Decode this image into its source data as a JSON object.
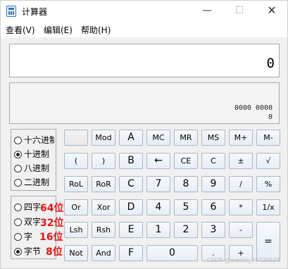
{
  "window": {
    "title": "计算器",
    "minimize": "—",
    "maximize": "☐",
    "close": "✕"
  },
  "menu": [
    "查看(V)",
    "编辑(E)",
    "帮助(H)"
  ],
  "display": {
    "value": "0"
  },
  "bits": {
    "row1": "0000   0000",
    "row2": "0"
  },
  "base_options": [
    {
      "label": "十六进制",
      "selected": false
    },
    {
      "label": "十进制",
      "selected": true
    },
    {
      "label": "八进制",
      "selected": false
    },
    {
      "label": "二进制",
      "selected": false
    }
  ],
  "word_options": [
    {
      "label": "四字",
      "selected": false
    },
    {
      "label": "双字",
      "selected": false
    },
    {
      "label": "字",
      "selected": false
    },
    {
      "label": "字节",
      "selected": true
    }
  ],
  "annotations": [
    "64位",
    "32位",
    "16位",
    "8位"
  ],
  "keys": {
    "r1": [
      "",
      "Mod",
      "A",
      "MC",
      "MR",
      "MS",
      "M+",
      "M-"
    ],
    "r2": [
      "(",
      ")",
      "B",
      "←",
      "CE",
      "C",
      "±",
      "√"
    ],
    "r3": [
      "RoL",
      "RoR",
      "C",
      "7",
      "8",
      "9",
      "/",
      "%"
    ],
    "r4": [
      "Or",
      "Xor",
      "D",
      "4",
      "5",
      "6",
      "*",
      "1/x"
    ],
    "r5": [
      "Lsh",
      "Rsh",
      "E",
      "1",
      "2",
      "3",
      "-",
      "="
    ],
    "r6": [
      "Not",
      "And",
      "F",
      "0",
      ".",
      "+"
    ]
  },
  "watermark": "CSDN @weixin_46720628"
}
